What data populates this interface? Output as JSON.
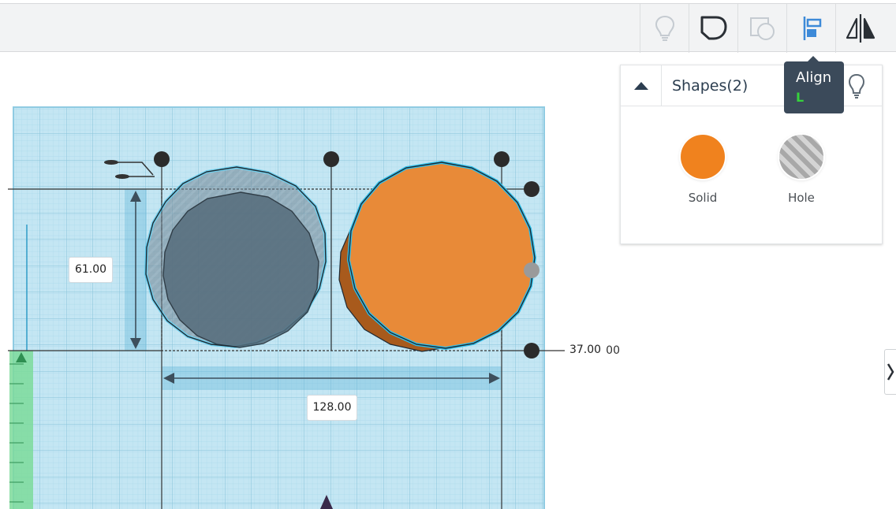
{
  "toolbar": {
    "tools": [
      {
        "name": "notes-tool",
        "icon": "lightbulb-icon",
        "enabled": false
      },
      {
        "name": "group-tool",
        "icon": "group-shape-icon",
        "enabled": true
      },
      {
        "name": "ungroup-tool",
        "icon": "ungroup-shape-icon",
        "enabled": false
      },
      {
        "name": "align-tool",
        "icon": "align-icon",
        "enabled": true
      },
      {
        "name": "mirror-tool",
        "icon": "mirror-icon",
        "enabled": true
      }
    ]
  },
  "tooltip": {
    "title": "Align",
    "shortcut": "L"
  },
  "panel": {
    "title": "Shapes(2)",
    "solid_label": "Solid",
    "hole_label": "Hole",
    "solid_color": "#f0821e"
  },
  "dimensions": {
    "width": "61.00",
    "length": "128.00",
    "height": "37.00",
    "elevation_fragment": "00"
  },
  "colors": {
    "grid_fill": "#c4e6f3",
    "grid_line": "#8fcbe2",
    "selection_outline": "#2cc0ec",
    "hole_fill": "#5a6e7c",
    "solid_fill": "#e88a38",
    "handle": "#2b2b2b",
    "ruler": "#7ddb9a"
  }
}
